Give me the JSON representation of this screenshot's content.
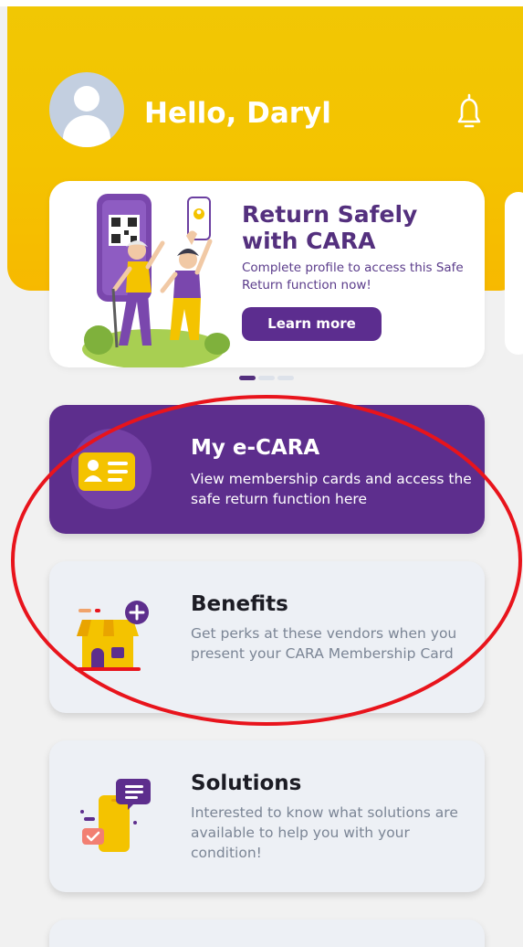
{
  "header": {
    "greeting": "Hello, Daryl",
    "background_color": "#f4c300",
    "avatar_icon": "user-avatar-icon",
    "notification_icon": "bell-icon"
  },
  "banner": {
    "title": "Return Safely with CARA",
    "subtitle": "Complete profile to access this Safe Return function now!",
    "button_label": "Learn more",
    "illustration": "two-people-waving-qr-code-illustration",
    "accent_color": "#54307e"
  },
  "carousel": {
    "pages": 3,
    "active_page": 1
  },
  "menu": [
    {
      "title": "My e-CARA",
      "description": "View membership cards and access the safe return function here",
      "icon": "membership-card-icon",
      "background": "#5d2e8d"
    },
    {
      "title": "Benefits",
      "description": "Get perks at these vendors when you present your CARA Membership Card",
      "icon": "shop-plus-icon",
      "background": "#edf0f5"
    },
    {
      "title": "Solutions",
      "description": "Interested to know what solutions are available to help you with your condition!",
      "icon": "phone-chat-icon",
      "background": "#edf0f5"
    }
  ],
  "annotation_color": "#e8141c"
}
